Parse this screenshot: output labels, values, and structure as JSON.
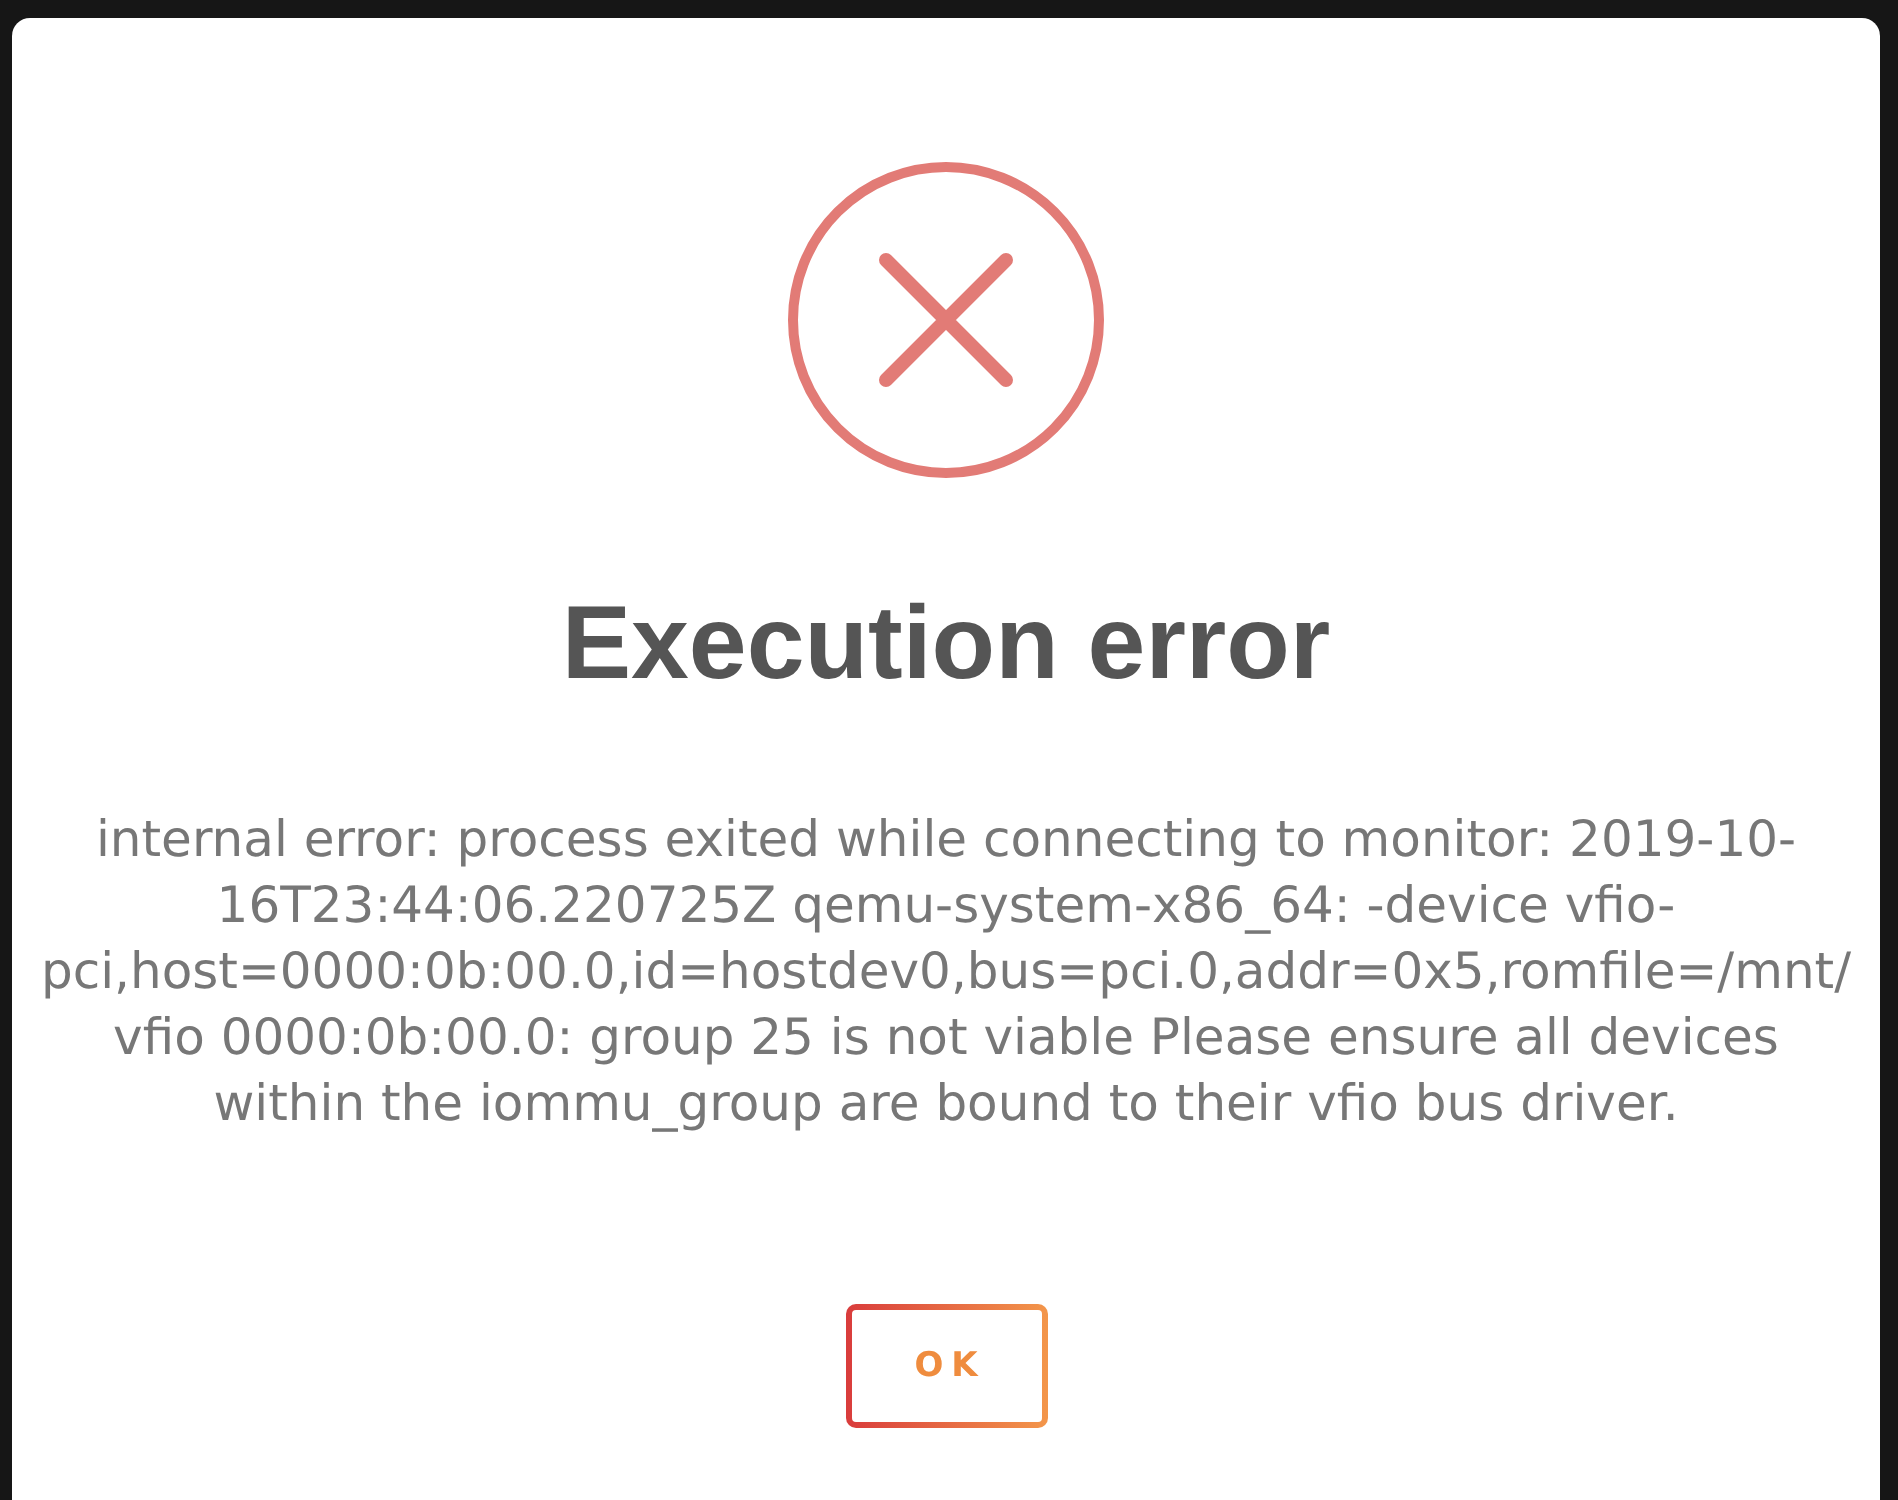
{
  "dialog": {
    "title": "Execution error",
    "message_lines": [
      "internal error: process exited while connecting to monitor: 2019-10-",
      "16T23:44:06.220725Z qemu-system-x86_64: -device vfio-",
      "pci,host=0000:0b:00.0,id=hostdev0,bus=pci.0,addr=0x5,romfile=/mnt/",
      "vfio 0000:0b:00.0: group 25 is not viable Please ensure all devices",
      "within the iommu_group are bound to their vfio bus driver."
    ],
    "buttons": [
      {
        "label": "OK"
      }
    ]
  }
}
